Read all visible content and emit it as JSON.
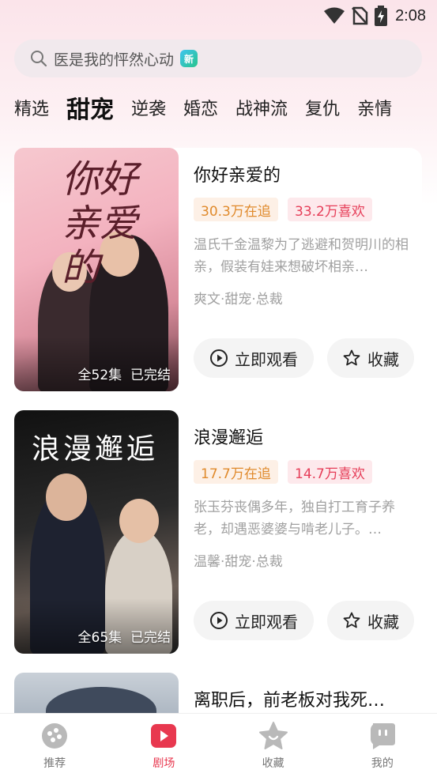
{
  "status": {
    "time": "2:08"
  },
  "search": {
    "text": "医是我的怦然心动",
    "badge": "新"
  },
  "tabs": [
    {
      "label": "精选",
      "active": false
    },
    {
      "label": "甜宠",
      "active": true
    },
    {
      "label": "逆袭",
      "active": false
    },
    {
      "label": "婚恋",
      "active": false
    },
    {
      "label": "战神流",
      "active": false
    },
    {
      "label": "复仇",
      "active": false
    },
    {
      "label": "亲情",
      "active": false
    }
  ],
  "dramas": [
    {
      "title": "你好亲爱的",
      "cover_title": "你好亲爱的",
      "episodes": "全52集",
      "status": "已完结",
      "follow": "30.3万在追",
      "likes": "33.2万喜欢",
      "description": "温氏千金温黎为了逃避和贺明川的相亲，假装有娃来想破坏相亲…",
      "genre": "爽文·甜宠·总裁",
      "watch_label": "立即观看",
      "fav_label": "收藏"
    },
    {
      "title": "浪漫邂逅",
      "cover_title": "浪漫邂逅",
      "episodes": "全65集",
      "status": "已完结",
      "follow": "17.7万在追",
      "likes": "14.7万喜欢",
      "description": "张玉芬丧偶多年，独自打工育子养老，却遇恶婆婆与啃老儿子。…",
      "genre": "温馨·甜宠·总裁",
      "watch_label": "立即观看",
      "fav_label": "收藏"
    },
    {
      "title": "离职后，前老板对我死…"
    }
  ],
  "nav": [
    {
      "label": "推荐",
      "icon": "recommend-icon",
      "active": false
    },
    {
      "label": "剧场",
      "icon": "theater-icon",
      "active": true
    },
    {
      "label": "收藏",
      "icon": "star-icon",
      "active": false
    },
    {
      "label": "我的",
      "icon": "profile-icon",
      "active": false
    }
  ],
  "colors": {
    "accent": "#e8384f",
    "follow_tag": "#e08a2c",
    "like_tag": "#e63e59"
  }
}
